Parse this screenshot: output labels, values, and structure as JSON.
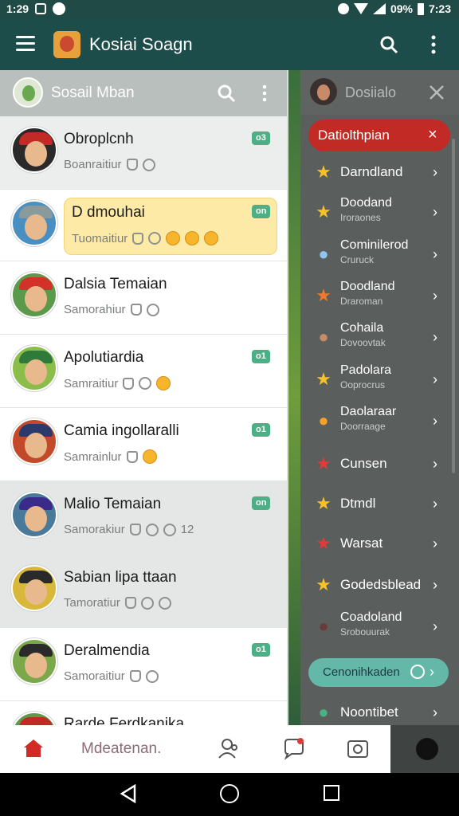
{
  "status_bar": {
    "time": "1:29",
    "right_text": "09%",
    "clock": "7:23"
  },
  "app_bar": {
    "title": "Kosiai Soagn"
  },
  "left_panel": {
    "title": "Sosail Mban",
    "chats": [
      {
        "name": "Obroplcnh",
        "preview": "Boanraitiur",
        "badge": "o3",
        "hat": "#c22a26",
        "bg": "#2a2a2a"
      },
      {
        "name": "D dmouhai",
        "preview": "Tuomaitiur",
        "badge": "on",
        "hat": "#8a9a9a",
        "bg": "#4a8fc2"
      },
      {
        "name": "Dalsia Temaian",
        "preview": "Samorahiur",
        "badge": "",
        "hat": "#d2322a",
        "bg": "#5a9a4a"
      },
      {
        "name": "Apolutiardia",
        "preview": "Samraitiur",
        "badge": "o1",
        "hat": "#2f7a3a",
        "bg": "#8bbd4a"
      },
      {
        "name": "Camia ingollaralli",
        "preview": "Samrainlur",
        "badge": "o1",
        "hat": "#2a3a6a",
        "bg": "#c24a2a"
      },
      {
        "name": "Malio Temaian",
        "preview": "Samorakiur",
        "badge": "on",
        "hat": "#3a2a8a",
        "bg": "#4a7a9a"
      },
      {
        "name": "Sabian lipa ttaan",
        "preview": "Tamoratiur",
        "badge": "",
        "hat": "#2a2a2a",
        "bg": "#d8b83a"
      },
      {
        "name": "Deralmendia",
        "preview": "Samoraitiur",
        "badge": "o1",
        "hat": "#2a2a2a",
        "bg": "#7aa84a"
      },
      {
        "name": "Rarde Ferdkanika",
        "preview": "",
        "badge": "",
        "hat": "#c22a26",
        "bg": "#5a9a4a"
      }
    ],
    "extra_count": "12"
  },
  "right_panel": {
    "title": "Dosiialo",
    "active_item": "Datiolthpian",
    "items": [
      {
        "label": "Darndland",
        "sub": "",
        "icon": "★",
        "color": "#f6c12a"
      },
      {
        "label": "Doodand",
        "sub": "Iroraones",
        "icon": "★",
        "color": "#f6c12a"
      },
      {
        "label": "Cominilerod",
        "sub": "Cruruck",
        "icon": "●",
        "color": "#8ec6f0"
      },
      {
        "label": "Doodland",
        "sub": "Draroman",
        "icon": "★",
        "color": "#f07a2a"
      },
      {
        "label": "Cohaila",
        "sub": "Dovoovtak",
        "icon": "●",
        "color": "#c98a6a"
      },
      {
        "label": "Padolara",
        "sub": "Ooprocrus",
        "icon": "★",
        "color": "#f6c12a"
      },
      {
        "label": "Daolaraar",
        "sub": "Doorraage",
        "icon": "●",
        "color": "#f6a02a"
      },
      {
        "label": "Cunsen",
        "sub": "",
        "icon": "★",
        "color": "#e03a3a"
      },
      {
        "label": "Dtmdl",
        "sub": "",
        "icon": "★",
        "color": "#f6c12a"
      },
      {
        "label": "Warsat",
        "sub": "",
        "icon": "★",
        "color": "#e03a3a"
      },
      {
        "label": "Godedsblead",
        "sub": "",
        "icon": "★",
        "color": "#f6c12a"
      },
      {
        "label": "Coadoland",
        "sub": "Srobouurak",
        "icon": "●",
        "color": "#6a3a3a"
      }
    ],
    "cta_label": "Cenonihkaden",
    "footer_item": "Noontibet"
  },
  "bottom_nav": {
    "label": "Mdeatenan."
  }
}
